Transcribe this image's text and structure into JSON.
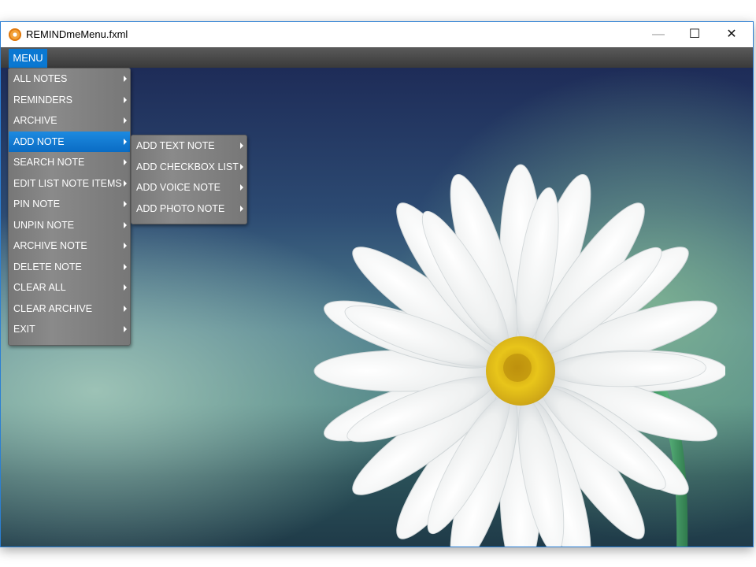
{
  "window": {
    "title": "REMINDmeMenu.fxml",
    "controls": {
      "minimize": "—",
      "maximize": "☐",
      "close": "✕"
    }
  },
  "menubar": {
    "menu_label": "MENU"
  },
  "menu": {
    "items": [
      {
        "label": "ALL NOTES"
      },
      {
        "label": "REMINDERS"
      },
      {
        "label": "ARCHIVE"
      },
      {
        "label": "ADD NOTE"
      },
      {
        "label": "SEARCH NOTE"
      },
      {
        "label": "EDIT LIST NOTE ITEMS"
      },
      {
        "label": "PIN NOTE"
      },
      {
        "label": "UNPIN NOTE"
      },
      {
        "label": "ARCHIVE NOTE"
      },
      {
        "label": "DELETE NOTE"
      },
      {
        "label": "CLEAR ALL"
      },
      {
        "label": "CLEAR ARCHIVE"
      },
      {
        "label": "EXIT"
      }
    ],
    "active_index": 3
  },
  "submenu": {
    "items": [
      {
        "label": "ADD TEXT NOTE"
      },
      {
        "label": "ADD CHECKBOX LIST"
      },
      {
        "label": "ADD VOICE NOTE"
      },
      {
        "label": "ADD PHOTO NOTE"
      }
    ]
  },
  "colors": {
    "accent": "#0a78d2",
    "menu_bg": "#808080",
    "window_border": "#2b7fd4"
  },
  "icons": {
    "app": "app-icon",
    "submenu_arrow": "chevron-right-icon"
  }
}
